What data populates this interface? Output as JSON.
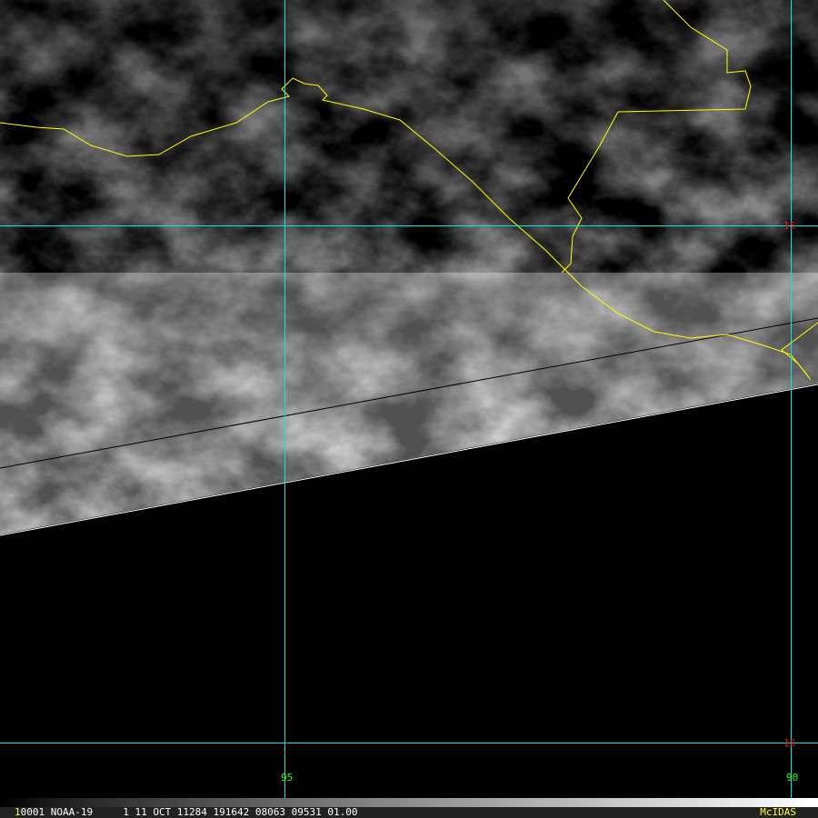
{
  "grid": {
    "lon_labels": [
      "95",
      "90"
    ],
    "lat_labels": [
      "15",
      "10"
    ]
  },
  "status_bar": {
    "frame_index": "1",
    "info": "0001 NOAA-19     1 11 OCT 11284 191642 08063 09531 01.00",
    "brand": "McIDAS"
  },
  "colors": {
    "grid": "#00e8e8",
    "coast": "#ffff00",
    "lon_label": "#20ff20",
    "lat_label": "#ff1010"
  }
}
